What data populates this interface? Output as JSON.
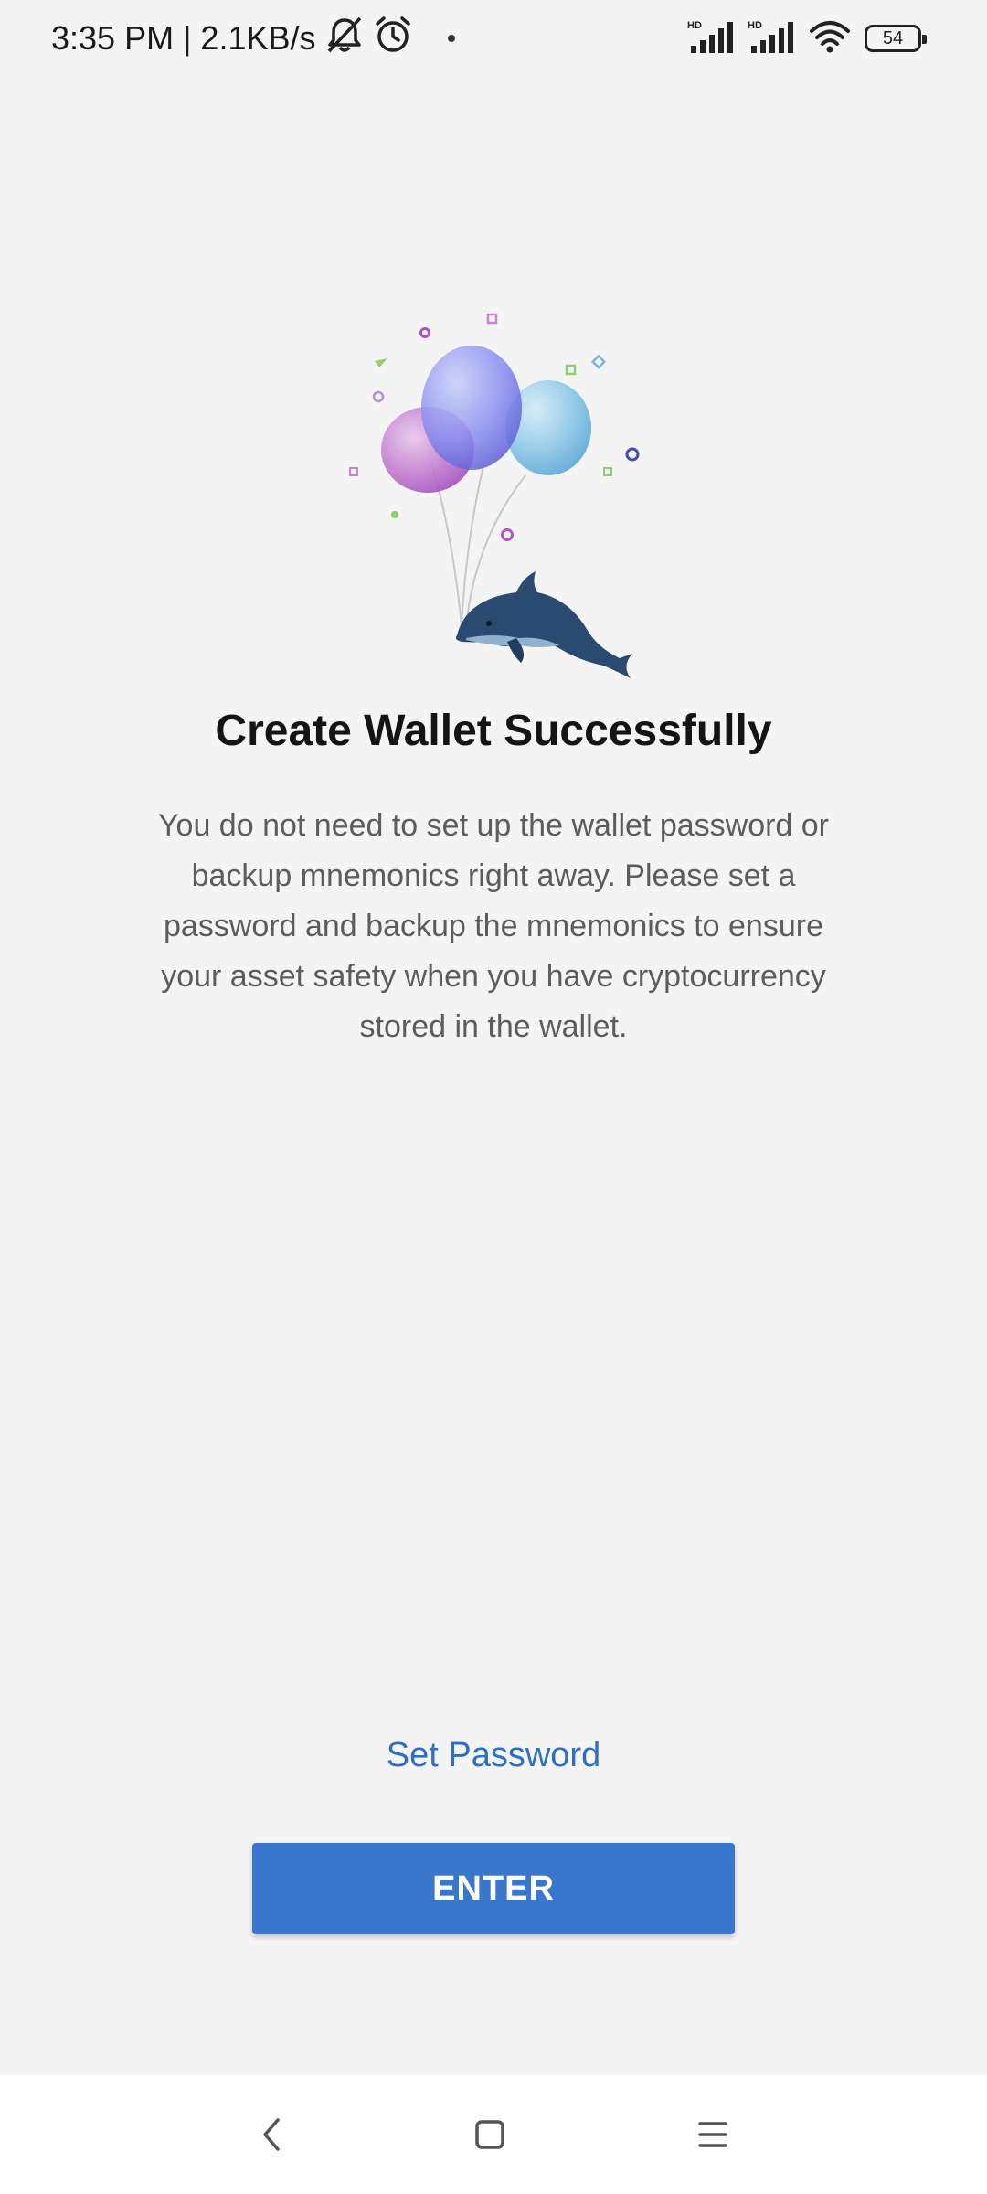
{
  "status_bar": {
    "time_speed": "3:35 PM | 2.1KB/s",
    "battery_level": "54",
    "icons": [
      "mute-bell-icon",
      "alarm-icon",
      "notification-dot",
      "hd-signal-icon",
      "hd-signal-icon",
      "wifi-icon",
      "battery-icon"
    ]
  },
  "main": {
    "title": "Create Wallet Successfully",
    "description": "You do not need to set up the wallet password or backup mnemonics right away. Please set a password and backup the mnemonics to ensure your asset safety when you have cryptocurrency stored in the wallet.",
    "illustration": "dolphin-with-balloons-illustration"
  },
  "actions": {
    "set_password_label": "Set Password",
    "enter_label": "ENTER"
  },
  "navigation_bar": {
    "icons": [
      "back-icon",
      "home-icon",
      "recents-icon"
    ]
  },
  "colors": {
    "background": "#f4f4f5",
    "accent": "#3a76cc",
    "link": "#2f6fbf"
  }
}
